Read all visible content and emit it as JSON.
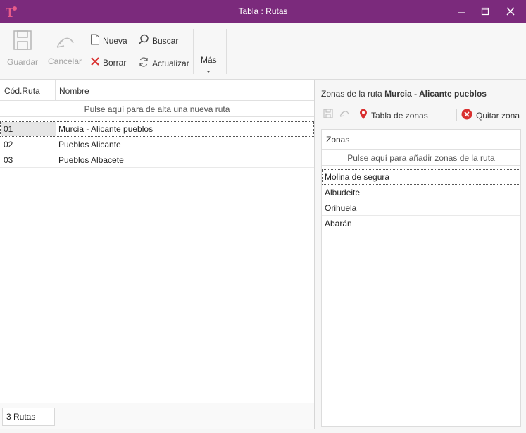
{
  "window": {
    "title": "Tabla : Rutas",
    "accent": "#7b2a7c"
  },
  "ribbon": {
    "guardar": "Guardar",
    "cancelar": "Cancelar",
    "nueva": "Nueva",
    "borrar": "Borrar",
    "buscar": "Buscar",
    "actualizar": "Actualizar",
    "mas": "Más"
  },
  "rutas": {
    "columns": [
      "Cód.Ruta",
      "Nombre"
    ],
    "new_row_hint": "Pulse aquí para de alta una nueva ruta",
    "rows": [
      {
        "code": "01",
        "name": "Murcia - Alicante pueblos"
      },
      {
        "code": "02",
        "name": "Pueblos Alicante"
      },
      {
        "code": "03",
        "name": "Pueblos Albacete"
      }
    ],
    "count": "3 Rutas"
  },
  "zonas": {
    "title_prefix": "Zonas de la ruta",
    "route_name": "Murcia - Alicante pueblos",
    "tabla_zonas": "Tabla de zonas",
    "quitar_zona": "Quitar zona",
    "column": "Zonas",
    "add_hint": "Pulse aquí para añadir zonas de  la ruta",
    "rows": [
      "Molina de segura",
      "Albudeite",
      "Orihuela",
      "Abarán"
    ]
  }
}
